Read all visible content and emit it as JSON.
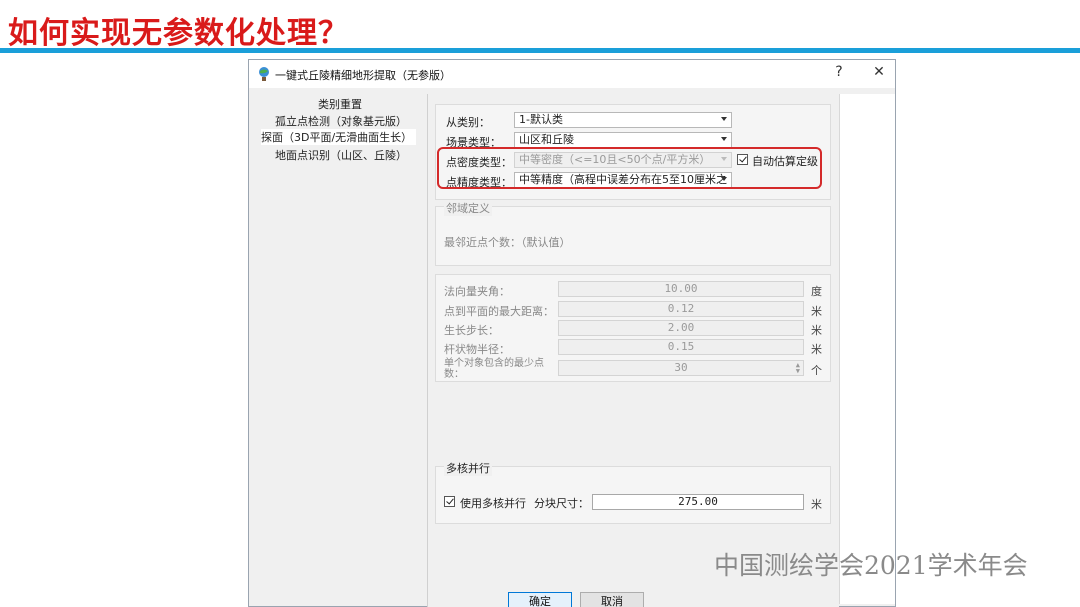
{
  "slide": {
    "title": "如何实现无参数化处理？",
    "watermark": "中国测绘学会2021学术年会"
  },
  "dialog": {
    "title": "一键式丘陵精细地形提取（无参版）",
    "help_label": "?",
    "close_label": "✕",
    "tree": {
      "header": "类别重置",
      "items": [
        {
          "label": "孤立点检测（对象基元版）"
        },
        {
          "label": "探面（3D平面/无滑曲面生长）"
        },
        {
          "label": "地面点识别（山区、丘陵）"
        }
      ]
    },
    "settings": {
      "from_class_label": "从类别：",
      "from_class_value": "1-默认类",
      "scene_type_label": "场景类型：",
      "scene_type_value": "山区和丘陵",
      "density_label": "点密度类型：",
      "density_value": "中等密度（<=10且<50个点/平方米）",
      "auto_estimate_label": "自动估算定级",
      "precision_label": "点精度类型：",
      "precision_value": "中等精度（高程中误差分布在5至10厘米之"
    },
    "neighborhood": {
      "group_label": "邻域定义",
      "neighbors_label": "最邻近点个数：（默认值）"
    },
    "params": [
      {
        "label": "法向量夹角：",
        "value": "10.00",
        "unit": "度"
      },
      {
        "label": "点到平面的最大距离：",
        "value": "0.12",
        "unit": "米"
      },
      {
        "label": "生长步长：",
        "value": "2.00",
        "unit": "米"
      },
      {
        "label": "杆状物半径：",
        "value": "0.15",
        "unit": "米"
      },
      {
        "label": "单个对象包含的最少点数：",
        "value": "30",
        "unit": "个"
      }
    ],
    "multicore": {
      "group_label": "多核并行",
      "use_label": "使用多核并行",
      "block_label": "分块尺寸：",
      "block_value": "275.00",
      "block_unit": "米"
    },
    "buttons": {
      "ok": "确定",
      "cancel": "取消"
    },
    "colors": {
      "highlight": "#d42a2a",
      "title_red": "#d91a1a",
      "rule_blue": "#1a9fd9"
    }
  }
}
